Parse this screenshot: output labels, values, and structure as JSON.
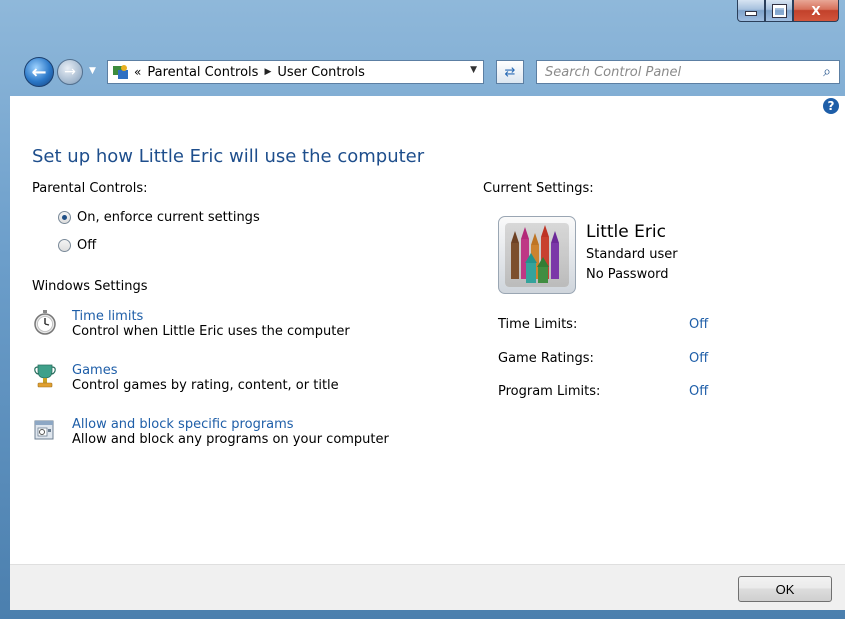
{
  "window": {
    "minimize_icon": "minimize-icon",
    "maximize_icon": "maximize-icon",
    "close_label": "X"
  },
  "nav": {
    "back_icon": "back-arrow-icon",
    "forward_icon": "forward-arrow-icon",
    "address_chevron": "«",
    "breadcrumb": [
      "Parental Controls",
      "User Controls"
    ],
    "search_placeholder": "Search Control Panel"
  },
  "main": {
    "heading": "Set up how Little Eric will use the computer",
    "parental_controls_label": "Parental Controls:",
    "radio_on": "On, enforce current settings",
    "radio_off": "Off",
    "radio_selected": "on",
    "windows_settings_label": "Windows Settings",
    "tasks": [
      {
        "title": "Time limits",
        "desc": "Control when Little Eric uses the computer",
        "icon": "stopwatch-icon"
      },
      {
        "title": "Games",
        "desc": "Control games by rating, content, or title",
        "icon": "trophy-icon"
      },
      {
        "title": "Allow and block specific programs",
        "desc": "Allow and block any programs on your computer",
        "icon": "program-window-icon"
      }
    ],
    "current_settings_label": "Current Settings:",
    "user": {
      "name": "Little Eric",
      "type": "Standard user",
      "password": "No Password",
      "avatar_icon": "crayons-icon"
    },
    "settings": [
      {
        "label": "Time Limits:",
        "value": "Off"
      },
      {
        "label": "Game Ratings:",
        "value": "Off"
      },
      {
        "label": "Program Limits:",
        "value": "Off"
      }
    ]
  },
  "footer": {
    "ok_label": "OK"
  },
  "colors": {
    "link": "#1e5ea8",
    "heading": "#1e4e8c",
    "frame": "#6d9fcb"
  }
}
